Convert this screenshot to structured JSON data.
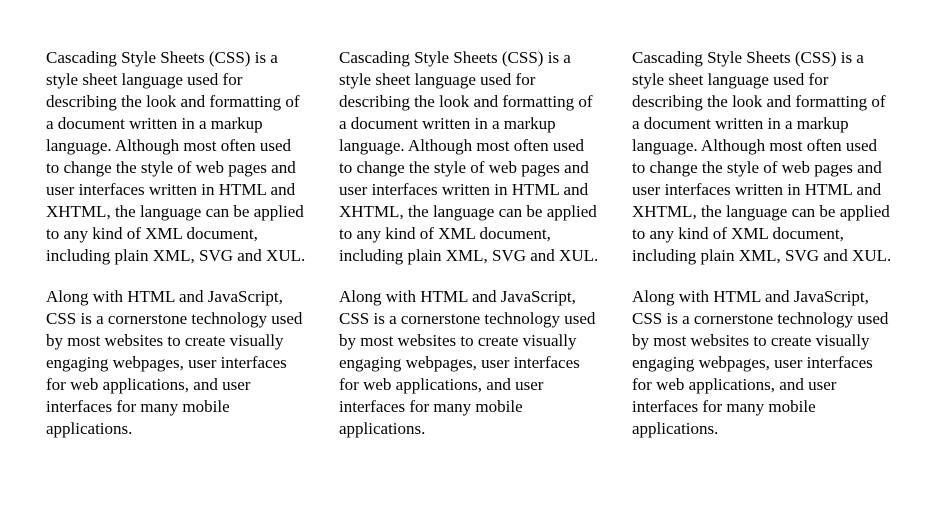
{
  "columns": [
    {
      "paragraphs": [
        "Cascading Style Sheets (CSS) is a style sheet language used for describing the look and formatting of a document written in a markup language. Although most often used to change the style of web pages and user interfaces written in HTML and XHTML, the language can be applied to any kind of XML document, including plain XML, SVG and XUL.",
        "Along with HTML and JavaScript, CSS is a cornerstone technology used by most websites to create visually engaging webpages, user interfaces for web applications, and user interfaces for many mobile applications."
      ]
    },
    {
      "paragraphs": [
        "Cascading Style Sheets (CSS) is a style sheet language used for describing the look and formatting of a document written in a markup language. Although most often used to change the style of web pages and user interfaces written in HTML and XHTML, the language can be applied to any kind of XML document, including plain XML, SVG and XUL.",
        "Along with HTML and JavaScript, CSS is a cornerstone technology used by most websites to create visually engaging webpages, user interfaces for web applications, and user interfaces for many mobile applications."
      ]
    },
    {
      "paragraphs": [
        "Cascading Style Sheets (CSS) is a style sheet language used for describing the look and formatting of a document written in a markup language. Although most often used to change the style of web pages and user interfaces written in HTML and XHTML, the language can be applied to any kind of XML document, including plain XML, SVG and XUL.",
        "Along with HTML and JavaScript, CSS is a cornerstone technology used by most websites to create visually engaging webpages, user interfaces for web applications, and user interfaces for many mobile applications."
      ]
    }
  ]
}
